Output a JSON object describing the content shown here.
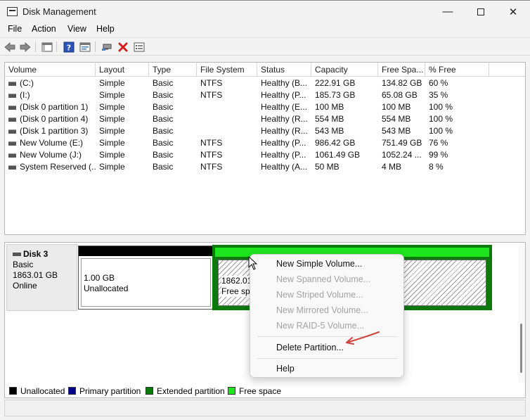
{
  "window": {
    "title": "Disk Management",
    "minimize": "—",
    "close": "✕"
  },
  "menu": [
    "File",
    "Action",
    "View",
    "Help"
  ],
  "toolbar": [
    {
      "icon": "back-arrow-icon"
    },
    {
      "icon": "forward-arrow-icon"
    },
    {
      "icon": "show-hide-console-tree-icon"
    },
    {
      "icon": "help-icon"
    },
    {
      "icon": "properties-icon"
    },
    {
      "icon": "connect-icon"
    },
    {
      "icon": "delete-icon",
      "color": "#d11f1f"
    },
    {
      "icon": "settings-list-icon"
    }
  ],
  "volume_table": {
    "columns": [
      "Volume",
      "Layout",
      "Type",
      "File System",
      "Status",
      "Capacity",
      "Free Spa...",
      "% Free"
    ],
    "rows": [
      [
        "(C:)",
        "Simple",
        "Basic",
        "NTFS",
        "Healthy (B...",
        "222.91 GB",
        "134.82 GB",
        "60 %"
      ],
      [
        "(I:)",
        "Simple",
        "Basic",
        "NTFS",
        "Healthy (P...",
        "185.73 GB",
        "65.08 GB",
        "35 %"
      ],
      [
        "(Disk 0 partition 1)",
        "Simple",
        "Basic",
        "",
        "Healthy (E...",
        "100 MB",
        "100 MB",
        "100 %"
      ],
      [
        "(Disk 0 partition 4)",
        "Simple",
        "Basic",
        "",
        "Healthy (R...",
        "554 MB",
        "554 MB",
        "100 %"
      ],
      [
        "(Disk 1 partition 3)",
        "Simple",
        "Basic",
        "",
        "Healthy (R...",
        "543 MB",
        "543 MB",
        "100 %"
      ],
      [
        "New Volume (E:)",
        "Simple",
        "Basic",
        "NTFS",
        "Healthy (P...",
        "986.42 GB",
        "751.49 GB",
        "76 %"
      ],
      [
        "New Volume (J:)",
        "Simple",
        "Basic",
        "NTFS",
        "Healthy (P...",
        "1061.49 GB",
        "1052.24 ...",
        "99 %"
      ],
      [
        "System Reserved (...",
        "Simple",
        "Basic",
        "NTFS",
        "Healthy (A...",
        "50 MB",
        "4 MB",
        "8 %"
      ]
    ]
  },
  "disk": {
    "name": "Disk 3",
    "type": "Basic",
    "size": "1863.01 GB",
    "status": "Online",
    "partitions": [
      {
        "size": "1.00 GB",
        "label": "Unallocated",
        "color": "#000000"
      },
      {
        "size": "1862.01",
        "label": "Free spa",
        "color": "#1fe51f",
        "border": "#0b7a0b"
      }
    ]
  },
  "legend": [
    {
      "label": "Unallocated",
      "color": "#000000"
    },
    {
      "label": "Primary partition",
      "color": "#00008b"
    },
    {
      "label": "Extended partition",
      "color": "#0b7a0b"
    },
    {
      "label": "Free space",
      "color": "#1fe51f"
    }
  ],
  "context_menu": {
    "items": [
      {
        "label": "New Simple Volume...",
        "enabled": true
      },
      {
        "label": "New Spanned Volume...",
        "enabled": false
      },
      {
        "label": "New Striped Volume...",
        "enabled": false
      },
      {
        "label": "New Mirrored Volume...",
        "enabled": false
      },
      {
        "label": "New RAID-5 Volume...",
        "enabled": false
      },
      {
        "label": "Delete Partition...",
        "enabled": true
      },
      {
        "label": "Help",
        "enabled": true
      }
    ],
    "annotation_color": "#d0433c"
  }
}
